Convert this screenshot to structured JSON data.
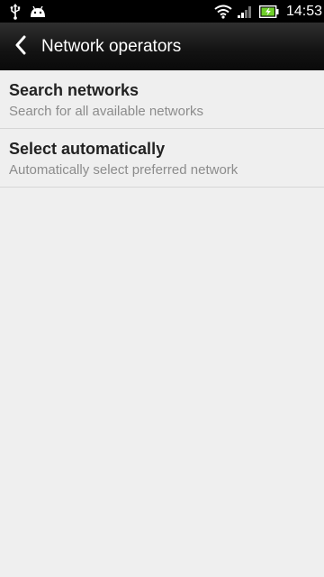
{
  "status_bar": {
    "icons": [
      "usb-icon",
      "android-icon",
      "wifi-icon",
      "signal-icon",
      "battery-charging-icon"
    ],
    "time": "14:53",
    "battery_color": "#6fcf2a"
  },
  "action_bar": {
    "back_icon": "chevron-left-icon",
    "title": "Network operators"
  },
  "list": {
    "items": [
      {
        "title": "Search networks",
        "subtitle": "Search for all available networks"
      },
      {
        "title": "Select automatically",
        "subtitle": "Automatically select preferred network"
      }
    ]
  }
}
